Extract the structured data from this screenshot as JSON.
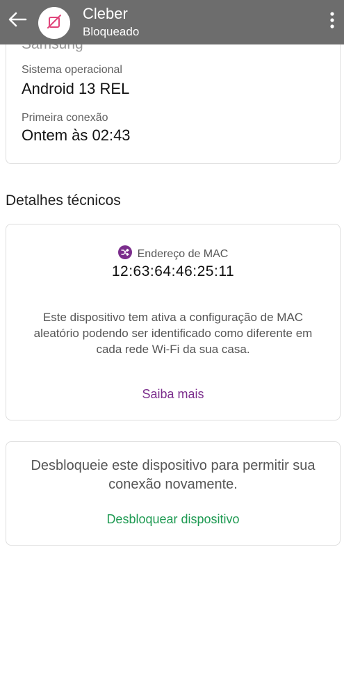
{
  "header": {
    "title": "Cleber",
    "subtitle": "Bloqueado",
    "back_icon": "arrow-left-icon",
    "avatar_icon": "device-blocked-icon",
    "more_icon": "more-vertical-icon",
    "background": "#6d6d6d",
    "blocked_color": "#e0457b"
  },
  "device_card": {
    "partial_value": "Samsung",
    "fields": [
      {
        "label": "Sistema operacional",
        "value": "Android 13 REL"
      },
      {
        "label": "Primeira conexão",
        "value": "Ontem às 02:43"
      }
    ]
  },
  "technical": {
    "section_title": "Detalhes técnicos",
    "mac_label": "Endereço de MAC",
    "mac_icon": "shuffle-icon",
    "mac_value": "12:63:64:46:25:11",
    "description": "Este dispositivo tem ativa a configuração de MAC aleatório podendo ser identificado como diferente em cada rede Wi-Fi da sua casa.",
    "link": "Saiba mais",
    "accent_color": "#7b2d8c"
  },
  "unblock_card": {
    "message": "Desbloqueie este dispositivo para permitir sua conexão novamente.",
    "action": "Desbloquear dispositivo",
    "action_color": "#1e9a52"
  }
}
